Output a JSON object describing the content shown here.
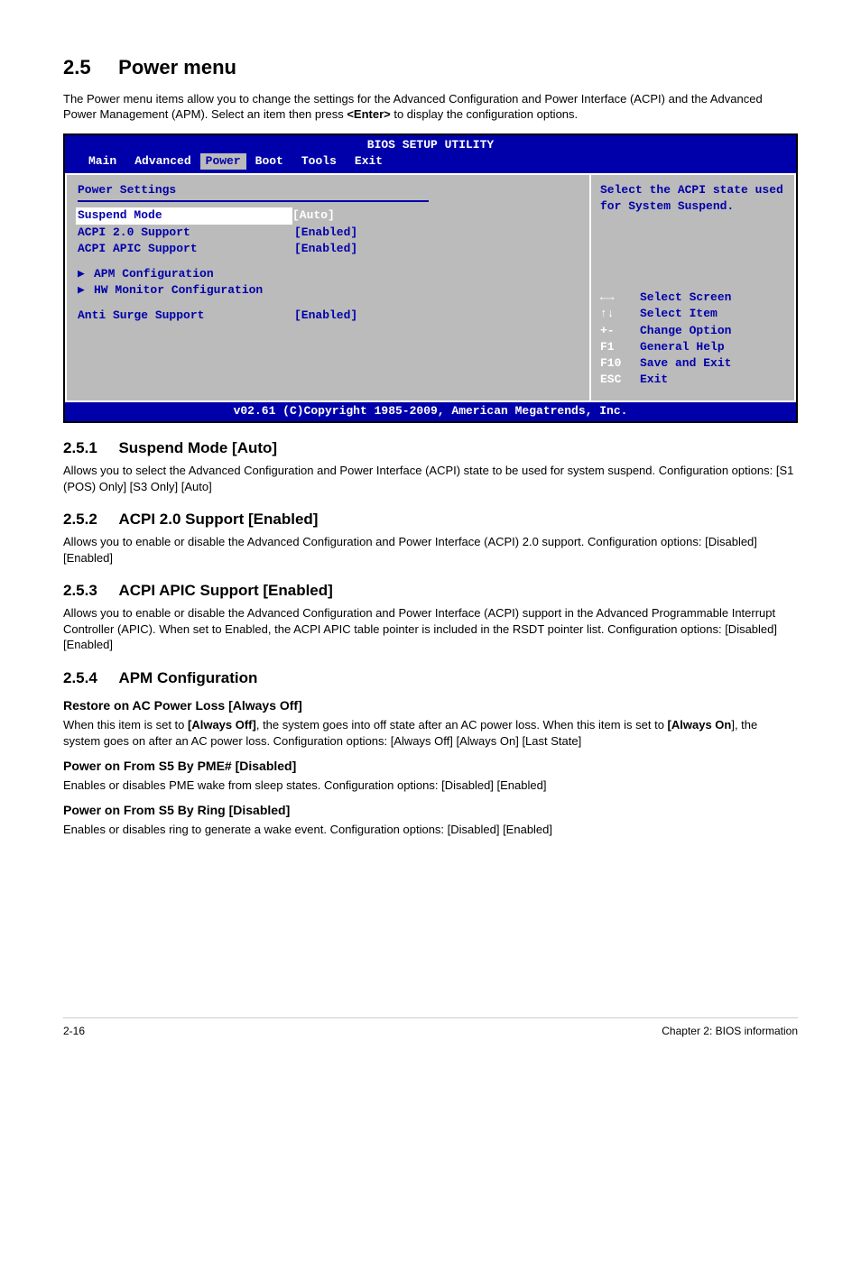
{
  "section": {
    "number": "2.5",
    "title": "Power menu",
    "intro": "The Power menu items allow you to change the settings for the Advanced Configuration and Power Interface (ACPI) and the Advanced Power Management (APM). Select an item then press <Enter> to display the configuration options."
  },
  "bios": {
    "title": "BIOS SETUP UTILITY",
    "tabs": [
      "Main",
      "Advanced",
      "Power",
      "Boot",
      "Tools",
      "Exit"
    ],
    "selected_tab": "Power",
    "heading": "Power Settings",
    "rows": [
      {
        "label": "Suspend Mode",
        "value": "[Auto]",
        "selected": true
      },
      {
        "label": "ACPI 2.0 Support",
        "value": "[Enabled]",
        "selected": false
      },
      {
        "label": "ACPI APIC Support",
        "value": "[Enabled]",
        "selected": false
      }
    ],
    "submenus": [
      "APM Configuration",
      "HW Monitor Configuration"
    ],
    "extra_row": {
      "label": "Anti Surge Support",
      "value": "[Enabled]"
    },
    "help_text": "Select the ACPI state used for System Suspend.",
    "legend": [
      {
        "key": "←→",
        "desc": "Select Screen"
      },
      {
        "key": "↑↓",
        "desc": "Select Item"
      },
      {
        "key": "+-",
        "desc": "Change Option"
      },
      {
        "key": "F1",
        "desc": "General Help"
      },
      {
        "key": "F10",
        "desc": "Save and Exit"
      },
      {
        "key": "ESC",
        "desc": "Exit"
      }
    ],
    "footer": "v02.61 (C)Copyright 1985-2009, American Megatrends, Inc."
  },
  "subsections": [
    {
      "num": "2.5.1",
      "title": "Suspend Mode [Auto]",
      "text": "Allows you to select the Advanced Configuration and Power Interface (ACPI) state to be used for system suspend. Configuration options: [S1 (POS) Only] [S3 Only] [Auto]"
    },
    {
      "num": "2.5.2",
      "title": "ACPI 2.0 Support [Enabled]",
      "text": "Allows you to enable or disable the Advanced Configuration and Power Interface (ACPI) 2.0 support. Configuration options: [Disabled] [Enabled]"
    },
    {
      "num": "2.5.3",
      "title": "ACPI APIC Support [Enabled]",
      "text": "Allows you to enable or disable the Advanced Configuration and Power Interface (ACPI) support in the Advanced Programmable Interrupt Controller (APIC). When set to Enabled, the ACPI APIC table pointer is included in the RSDT pointer list. Configuration options: [Disabled] [Enabled]"
    },
    {
      "num": "2.5.4",
      "title": "APM Configuration",
      "text": ""
    }
  ],
  "sub_items": [
    {
      "heading": "Restore on AC Power Loss [Always Off]",
      "text_parts": [
        "When this item is set to ",
        "[Always Off]",
        ", the system goes into off state after an AC power loss. When this item is set to ",
        "[Always On",
        "], the system goes on after an AC power loss. Configuration options: [Always Off] [Always On] [Last State]"
      ]
    },
    {
      "heading": "Power on From S5 By PME# [Disabled]",
      "text": "Enables or disables PME wake from sleep states. Configuration options: [Disabled] [Enabled]"
    },
    {
      "heading": "Power on From S5 By Ring [Disabled]",
      "text": "Enables or disables ring to generate a wake event. Configuration options: [Disabled] [Enabled]"
    }
  ],
  "footer": {
    "left": "2-16",
    "right": "Chapter 2: BIOS information"
  },
  "enter_key": "<Enter>"
}
